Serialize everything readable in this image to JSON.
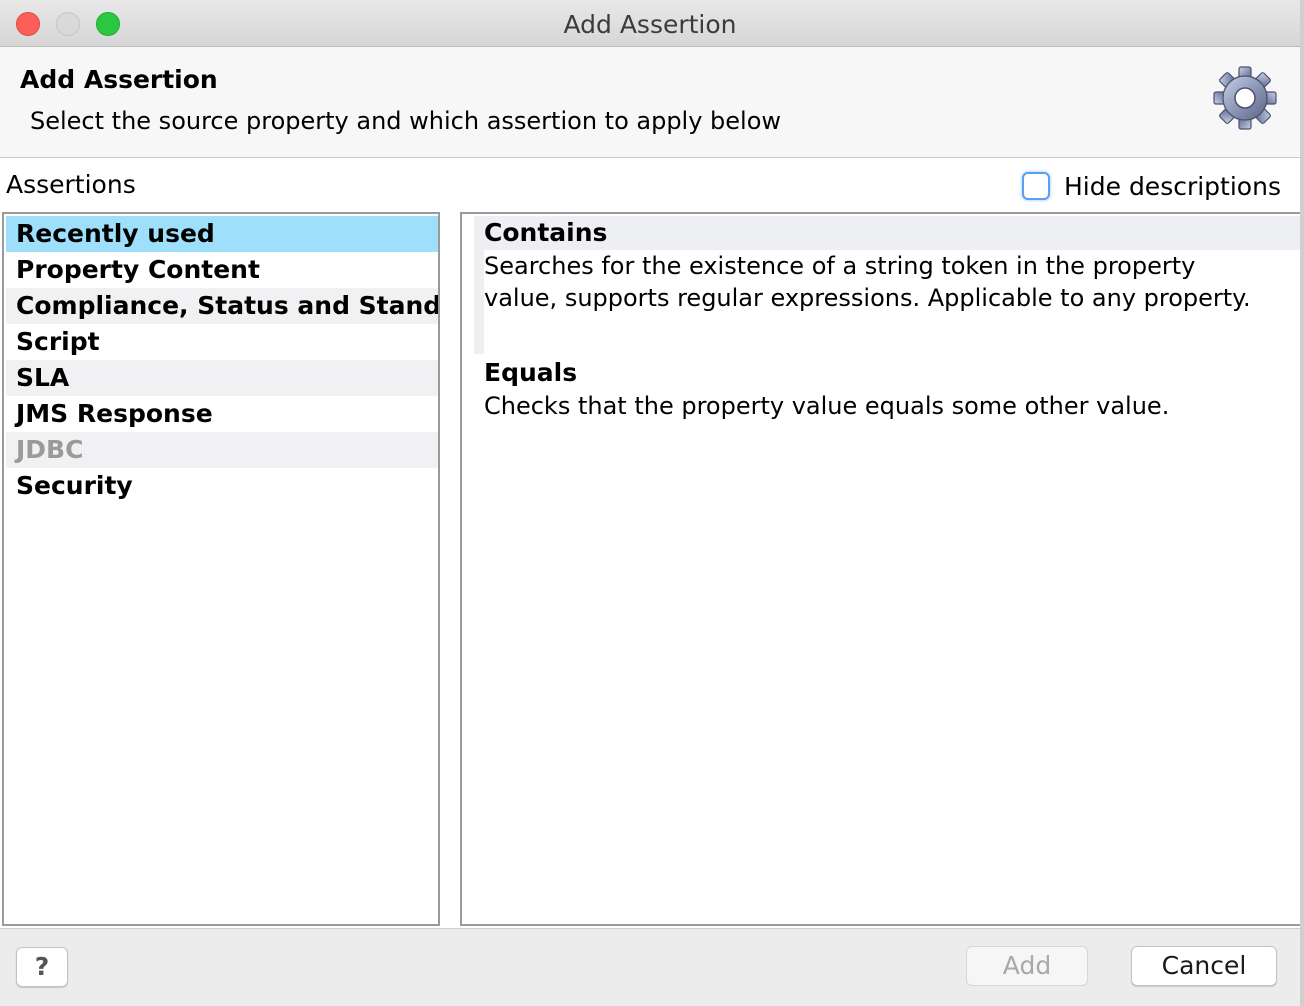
{
  "window": {
    "title": "Add Assertion"
  },
  "header": {
    "title": "Add Assertion",
    "subtitle": "Select the source property and which assertion to apply below",
    "icon": "gear-icon"
  },
  "assertions_label": "Assertions",
  "hide_descriptions": {
    "label": "Hide descriptions",
    "checked": false
  },
  "categories": [
    {
      "label": "Recently used",
      "selected": true,
      "disabled": false
    },
    {
      "label": "Property Content",
      "selected": false,
      "disabled": false
    },
    {
      "label": "Compliance, Status and Stand...",
      "selected": false,
      "disabled": false
    },
    {
      "label": "Script",
      "selected": false,
      "disabled": false
    },
    {
      "label": "SLA",
      "selected": false,
      "disabled": false
    },
    {
      "label": "JMS Response",
      "selected": false,
      "disabled": false
    },
    {
      "label": "JDBC",
      "selected": false,
      "disabled": true
    },
    {
      "label": "Security",
      "selected": false,
      "disabled": false
    }
  ],
  "assertions": [
    {
      "name": "Contains",
      "description_lines": [
        "Searches for the existence of a string token in the property",
        "value, supports regular expressions. Applicable to any property."
      ]
    },
    {
      "name": "Equals",
      "description_lines": [
        "Checks that the property value equals some other value."
      ]
    }
  ],
  "footer": {
    "help_label": "?",
    "add_label": "Add",
    "cancel_label": "Cancel"
  },
  "colors": {
    "selection": "#9ee0fb",
    "close": "#fc5f57",
    "maximize": "#2ac840",
    "checkbox_focus": "#5a9ff0"
  }
}
